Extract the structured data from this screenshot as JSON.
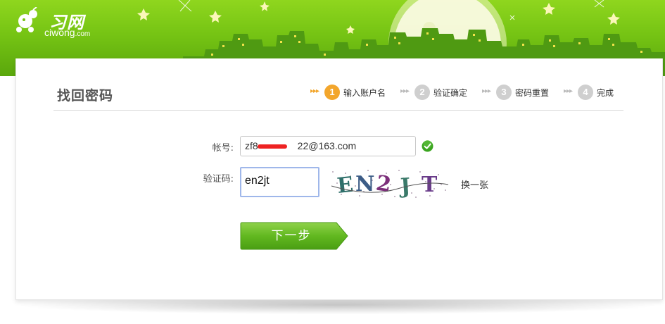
{
  "logo": {
    "cn": "习网",
    "en": "ciwong",
    "domain": ".com"
  },
  "page": {
    "title": "找回密码"
  },
  "steps": [
    {
      "num": "1",
      "label": "输入账户名",
      "active": true
    },
    {
      "num": "2",
      "label": "验证确定",
      "active": false
    },
    {
      "num": "3",
      "label": "密码重置",
      "active": false
    },
    {
      "num": "4",
      "label": "完成",
      "active": false
    }
  ],
  "form": {
    "account_label": "帐号:",
    "account_value": "zf8    22@163.com",
    "captcha_label": "验证码:",
    "captcha_value": "en2jt",
    "captcha_image_text": "EN2JT",
    "refresh_label": "换一张",
    "next_label": "下一步"
  },
  "colors": {
    "banner_green": "#76c414",
    "step_active": "#f3a62c",
    "step_inactive": "#cfcfcf",
    "button_green": "#5cb41c",
    "check_green": "#3aa51f"
  }
}
